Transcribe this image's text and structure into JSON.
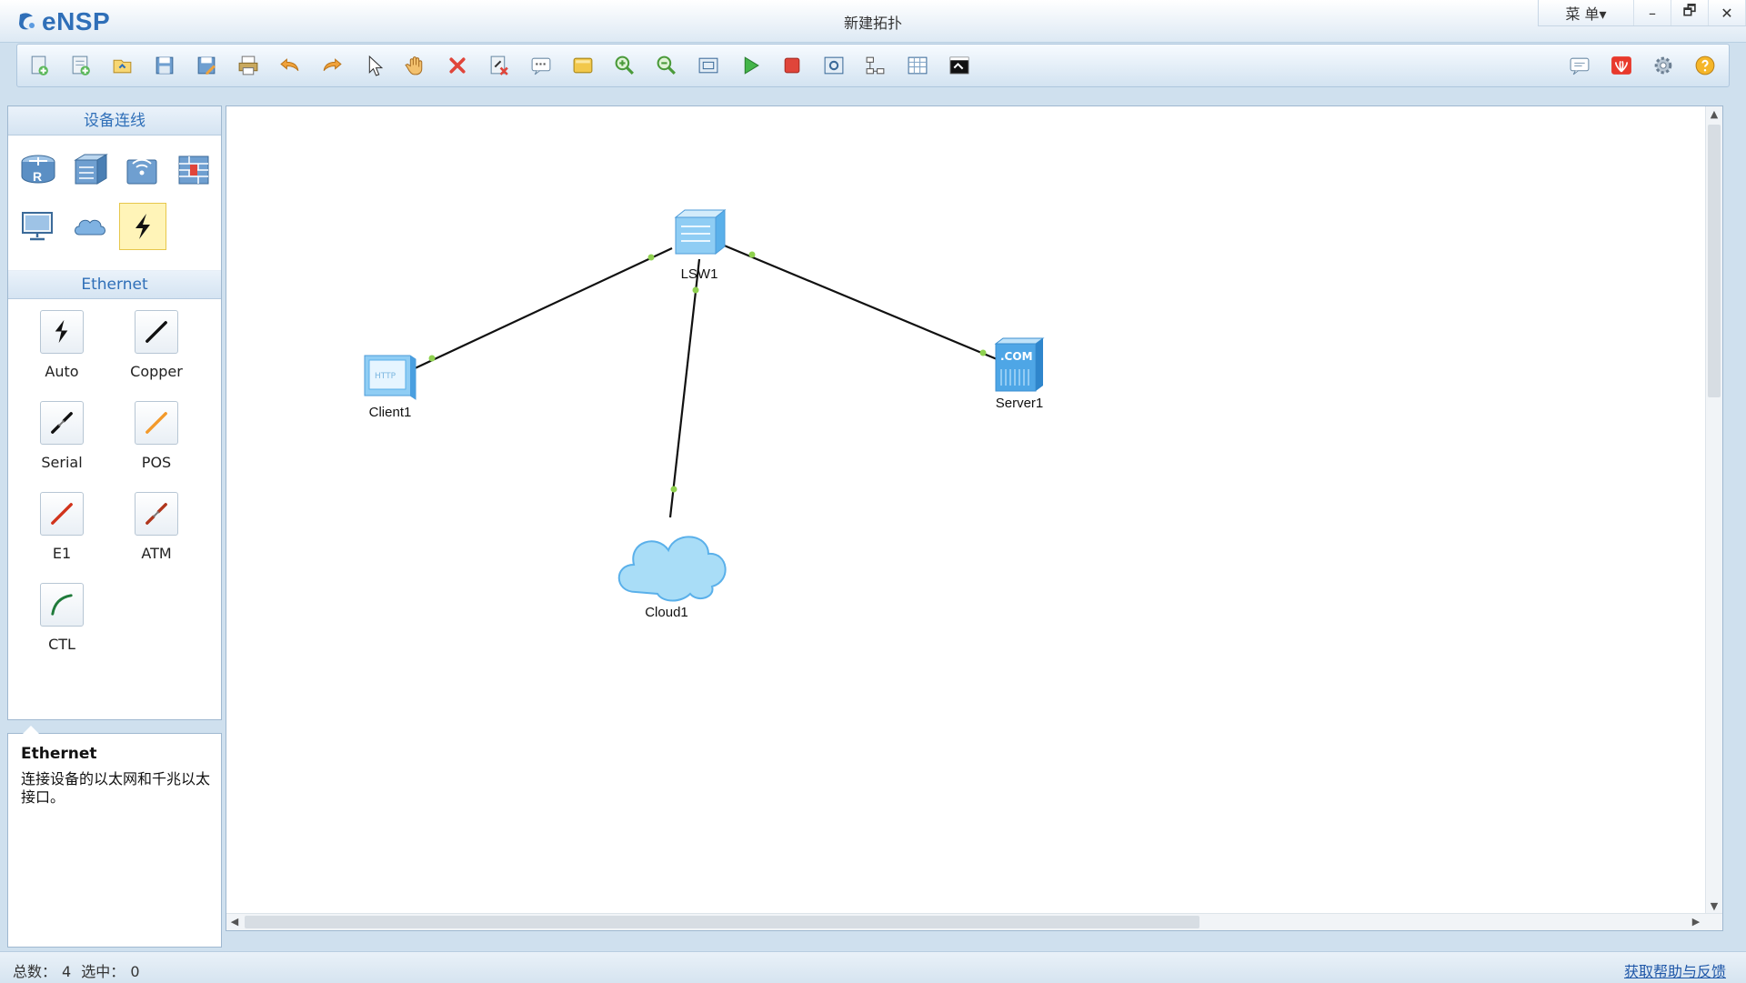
{
  "app": {
    "logo_text": "eNSP",
    "window_title": "新建拓扑",
    "menu_label": "菜 单▾",
    "minimize": "–",
    "restore": "🗗",
    "close": "✕"
  },
  "toolbar": {
    "tools": [
      {
        "name": "new-topology-icon"
      },
      {
        "name": "new-exam-icon"
      },
      {
        "name": "open-icon"
      },
      {
        "name": "save-icon"
      },
      {
        "name": "save-as-icon"
      },
      {
        "name": "print-icon"
      },
      {
        "name": "undo-icon"
      },
      {
        "name": "redo-icon"
      },
      {
        "name": "select-pointer-icon"
      },
      {
        "name": "hand-pan-icon"
      },
      {
        "name": "delete-icon"
      },
      {
        "name": "delete-link-icon"
      },
      {
        "name": "text-note-icon"
      },
      {
        "name": "palette-icon"
      },
      {
        "name": "zoom-in-icon"
      },
      {
        "name": "zoom-out-icon"
      },
      {
        "name": "fit-view-icon"
      },
      {
        "name": "start-device-icon"
      },
      {
        "name": "stop-device-icon"
      },
      {
        "name": "capture-icon"
      },
      {
        "name": "topology-icon"
      },
      {
        "name": "grid-icon"
      },
      {
        "name": "console-icon"
      }
    ],
    "right_tools": [
      {
        "name": "chat-icon"
      },
      {
        "name": "huawei-icon"
      },
      {
        "name": "settings-icon"
      },
      {
        "name": "help-icon"
      }
    ]
  },
  "left_panel": {
    "devices_header": "设备连线",
    "devices": [
      {
        "name": "router-icon"
      },
      {
        "name": "switch-icon"
      },
      {
        "name": "wireless-icon"
      },
      {
        "name": "firewall-icon"
      },
      {
        "name": "pc-icon"
      },
      {
        "name": "cloud-icon"
      },
      {
        "name": "connection-icon"
      }
    ],
    "cables_header": "Ethernet",
    "cables": [
      {
        "label": "Auto",
        "color": "#111111"
      },
      {
        "label": "Copper",
        "color": "#111111"
      },
      {
        "label": "Serial",
        "color": "#111111"
      },
      {
        "label": "POS",
        "color": "#f39a2b"
      },
      {
        "label": "E1",
        "color": "#d1331b"
      },
      {
        "label": "ATM",
        "color": "#b0361c"
      },
      {
        "label": "CTL",
        "color": "#1f7a3a"
      }
    ]
  },
  "description": {
    "title": "Ethernet",
    "text": "连接设备的以太网和千兆以太接口。"
  },
  "topology": {
    "nodes": [
      {
        "id": "LSW1",
        "label": "LSW1",
        "type": "switch"
      },
      {
        "id": "Client1",
        "label": "Client1",
        "type": "client"
      },
      {
        "id": "Server1",
        "label": "Server1",
        "type": "server"
      },
      {
        "id": "Cloud1",
        "label": "Cloud1",
        "type": "cloud"
      }
    ],
    "links": [
      {
        "from": "LSW1",
        "to": "Client1"
      },
      {
        "from": "LSW1",
        "to": "Server1"
      },
      {
        "from": "LSW1",
        "to": "Cloud1"
      }
    ],
    "port_color": "#8fd14f",
    "client_tag": "HTTP",
    "server_tag": ".COM"
  },
  "status": {
    "total_label": "总数：",
    "total_value": "4",
    "selected_label": "选中：",
    "selected_value": "0",
    "help_link": "获取帮助与反馈"
  }
}
